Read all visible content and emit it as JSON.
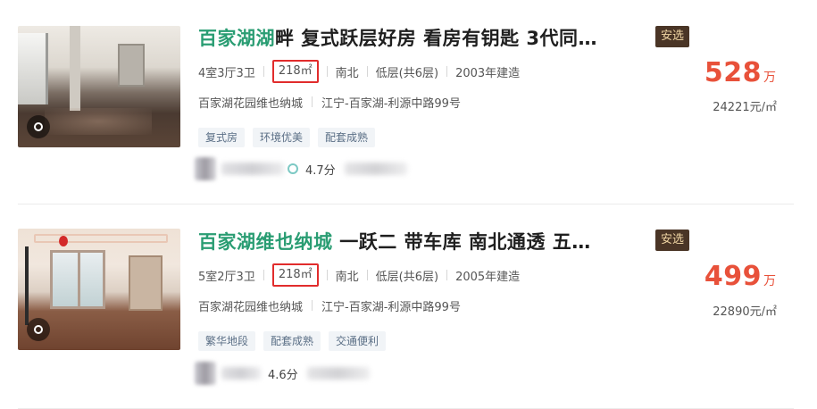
{
  "listings": [
    {
      "title_highlight": "百家湖湖",
      "title_rest": "畔 复式跃层好房 看房有钥匙 3代同…",
      "badge": "安选",
      "layout": "4室3厅3卫",
      "area": "218㎡",
      "orientation": "南北",
      "floor": "低层(共6层)",
      "built": "2003年建造",
      "community": "百家湖花园维也纳城",
      "location": "江宁-百家湖-利源中路99号",
      "tags": [
        "复式房",
        "环境优美",
        "配套成熟"
      ],
      "agent_score": "4.7分",
      "price": "528",
      "price_unit": "万",
      "unit_price": "24221元/㎡"
    },
    {
      "title_highlight": "百家湖维也纳城",
      "title_rest": " 一跃二 带车库 南北通透 五…",
      "badge": "安选",
      "layout": "5室2厅3卫",
      "area": "218㎡",
      "orientation": "南北",
      "floor": "低层(共6层)",
      "built": "2005年建造",
      "community": "百家湖花园维也纳城",
      "location": "江宁-百家湖-利源中路99号",
      "tags": [
        "繁华地段",
        "配套成熟",
        "交通便利"
      ],
      "agent_score": "4.6分",
      "price": "499",
      "price_unit": "万",
      "unit_price": "22890元/㎡"
    }
  ],
  "colors": {
    "title_highlight": "#2a9d73",
    "price": "#e8513a",
    "area_box": "#e12c2c",
    "badge_bg": "#4a3526",
    "badge_text": "#f0d5a3",
    "chip_bg": "#f1f4f7",
    "chip_text": "#5b6f86"
  }
}
